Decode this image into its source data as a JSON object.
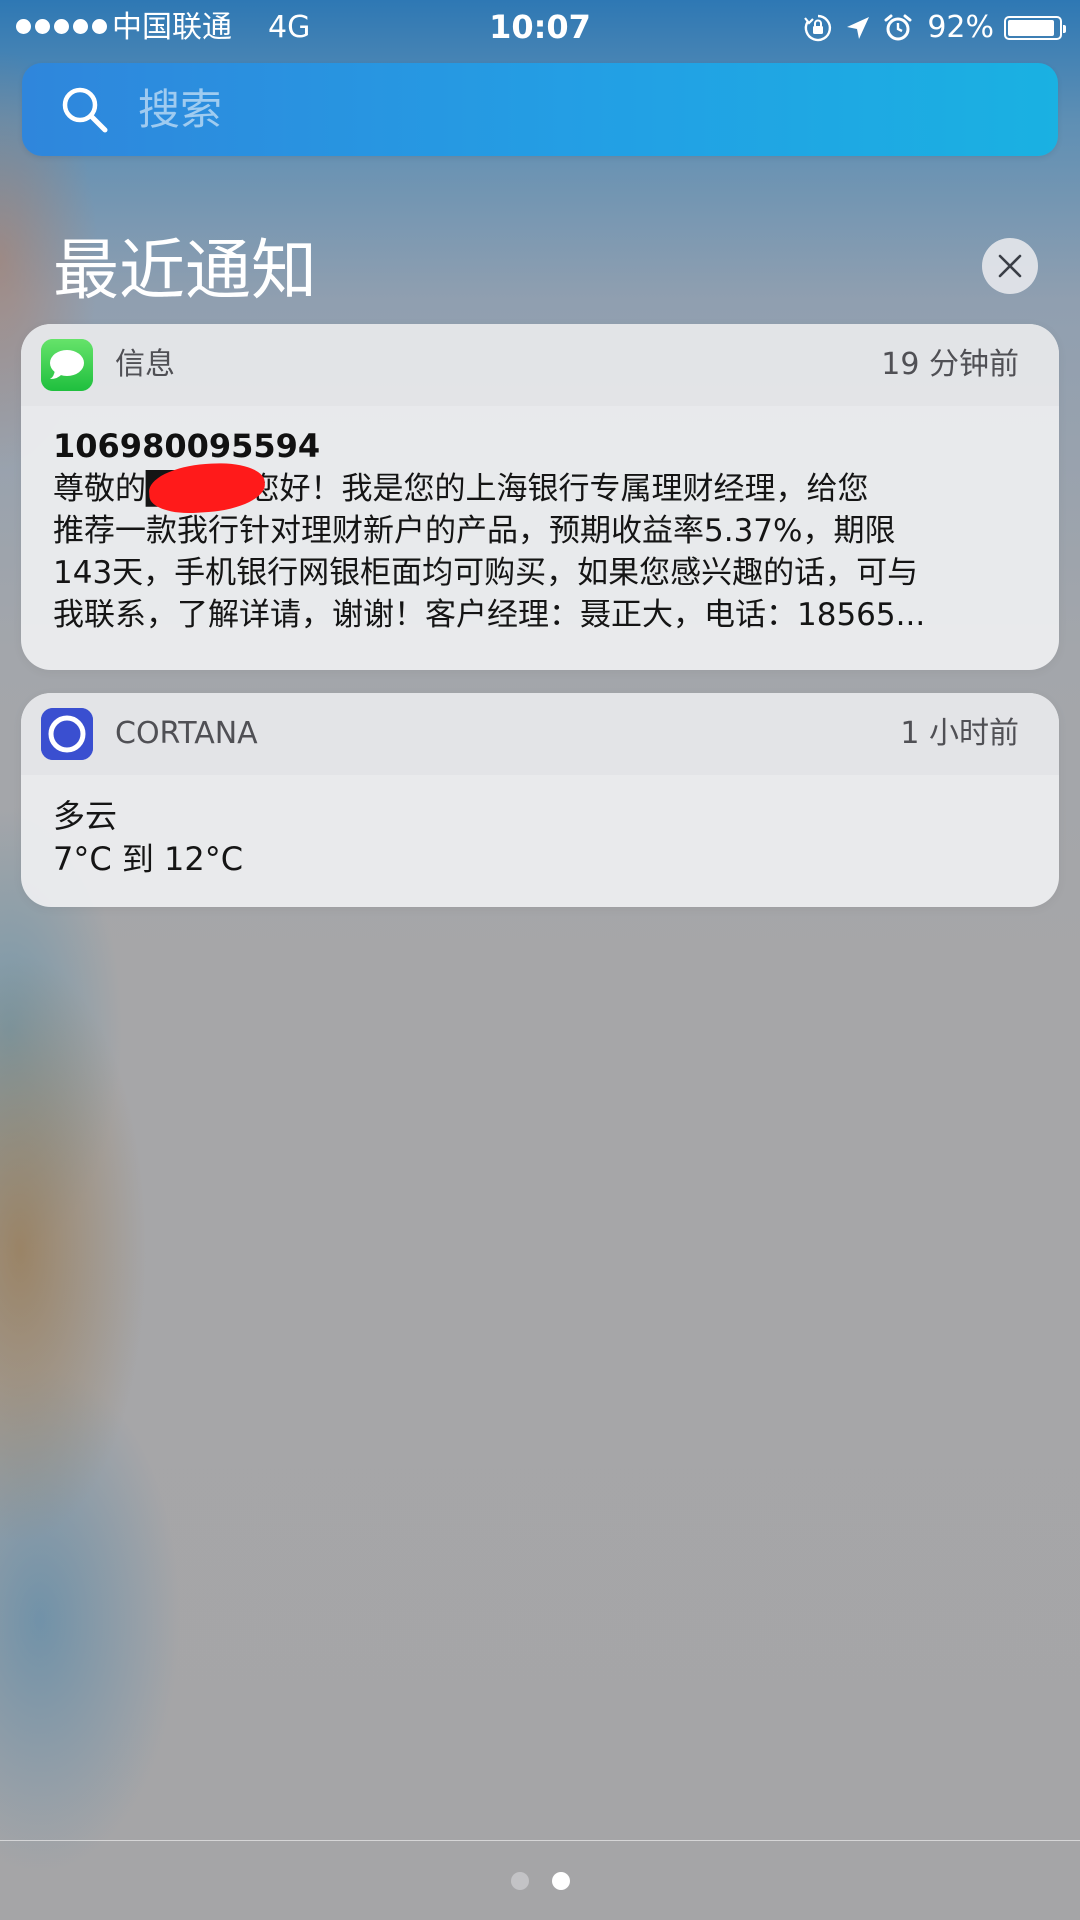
{
  "status_bar": {
    "carrier": "中国联通",
    "network": "4G",
    "time": "10:07",
    "battery_percent": "92%",
    "battery_level": 0.92,
    "icons": [
      "orientation-lock-icon",
      "location-arrow-icon",
      "alarm-icon"
    ]
  },
  "search": {
    "placeholder": "搜索"
  },
  "section": {
    "title": "最近通知"
  },
  "notifications": [
    {
      "app": "信息",
      "icon": "messages-icon",
      "time": "19 分钟前",
      "sender": "106980095594",
      "message_lines": [
        "尊敬的███，您好！我是您的上海银行专属理财经理，给您",
        "推荐一款我行针对理财新户的产品，预期收益率5.37%，期限",
        "143天，手机银行网银柜面均可购买，如果您感兴趣的话，可与",
        "我联系，了解详请，谢谢！客户经理：聂正大，电话：18565..."
      ]
    },
    {
      "app": "CORTANA",
      "icon": "cortana-icon",
      "time": "1 小时前",
      "lines": [
        "多云",
        "7°C 到 12°C"
      ]
    }
  ],
  "page_indicator": {
    "count": 2,
    "active_index": 1
  },
  "colors": {
    "messages_green": "#4cd964",
    "cortana_blue": "#3a4fd0",
    "search_blue": "#239fe4",
    "redaction_red": "#ff1a1a"
  }
}
